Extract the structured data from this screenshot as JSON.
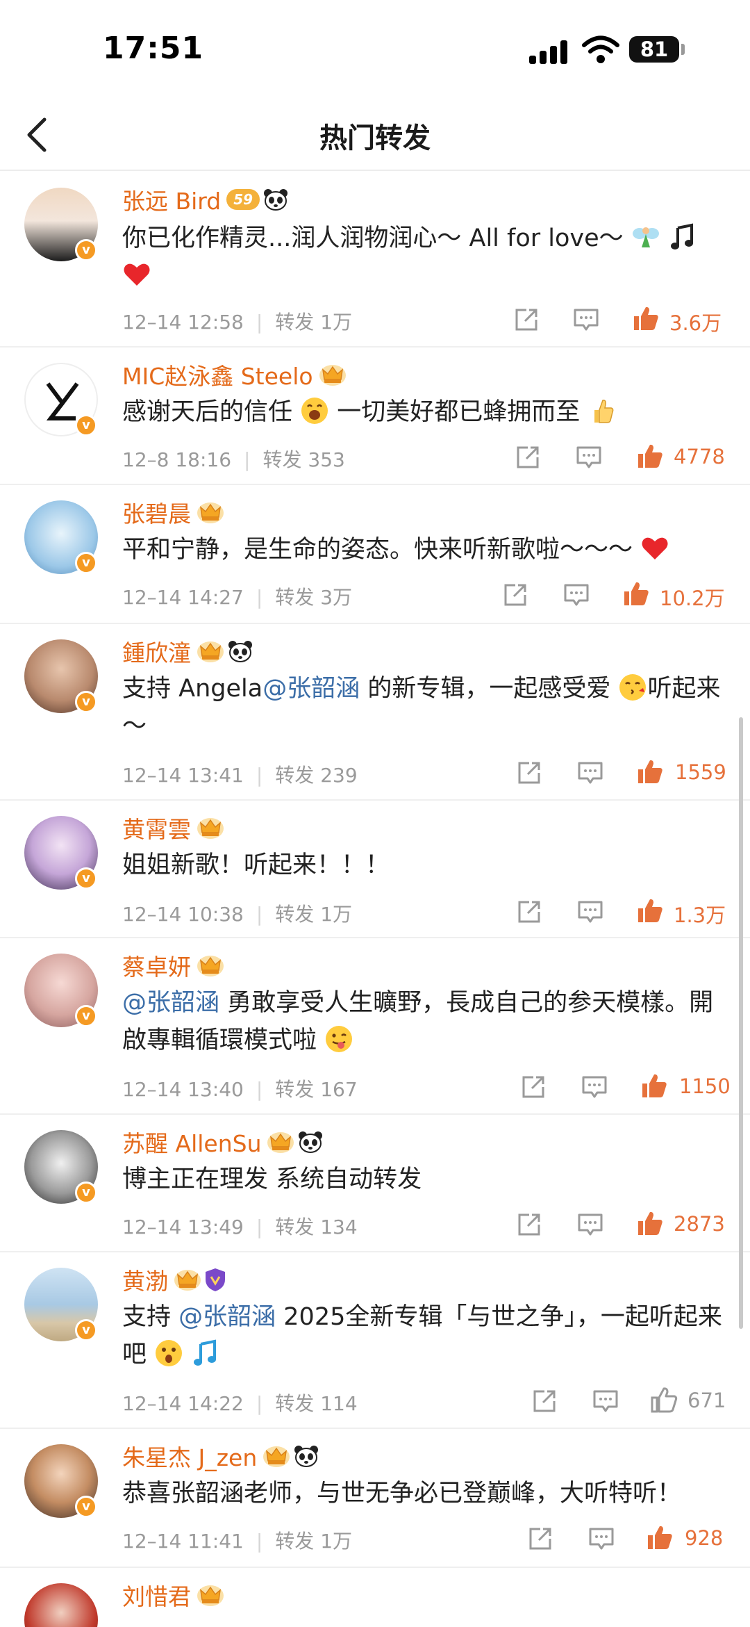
{
  "status_bar": {
    "time": "17:51",
    "battery": "81"
  },
  "header": {
    "title": "热门转发"
  },
  "colors": {
    "name": "#e46a1a",
    "like_active": "#e6713b",
    "mention": "#3c6ea8",
    "meta": "#9a9a9a"
  },
  "items": [
    {
      "name": "张远 Bird",
      "badges": [
        "level-badge",
        "panda-icon"
      ],
      "level": "59",
      "text": "你已化作精灵...润人润物润心～ All for love～",
      "time": "12–14 12:58",
      "repost_label": "转发",
      "reposts": "1万",
      "likes": "3.6万",
      "liked": true
    },
    {
      "name": "MIC赵泳鑫 Steelo",
      "badges": [
        "crown-icon"
      ],
      "text": "感谢天后的信任",
      "text2": " 一切美好都已蜂拥而至",
      "time": "12–8 18:16",
      "repost_label": "转发",
      "reposts": "353",
      "likes": "4778",
      "liked": true
    },
    {
      "name": "张碧晨",
      "badges": [
        "crown-icon"
      ],
      "text": "平和宁静，是生命的姿态。快来听新歌啦～～～",
      "time": "12–14 14:27",
      "repost_label": "转发",
      "reposts": "3万",
      "likes": "10.2万",
      "liked": true
    },
    {
      "name": "鍾欣潼",
      "badges": [
        "crown-icon",
        "panda-icon"
      ],
      "text_a": "支持 Angela",
      "mention": "@张韶涵",
      "text_b": " 的新专辑，一起感受爱",
      "text_c": "听起来～",
      "time": "12–14 13:41",
      "repost_label": "转发",
      "reposts": "239",
      "likes": "1559",
      "liked": true
    },
    {
      "name": "黄霄雲",
      "badges": [
        "crown-icon"
      ],
      "text": "姐姐新歌！听起来！！！",
      "time": "12–14 10:38",
      "repost_label": "转发",
      "reposts": "1万",
      "likes": "1.3万",
      "liked": true
    },
    {
      "name": "蔡卓妍",
      "badges": [
        "crown-icon"
      ],
      "mention": "@张韶涵",
      "text_a": " 勇敢享受人生曠野，長成自己的参天模樣。開啟專輯循環模式啦",
      "time": "12–14 13:40",
      "repost_label": "转发",
      "reposts": "167",
      "likes": "1150",
      "liked": true
    },
    {
      "name": "苏醒 AllenSu",
      "badges": [
        "crown-icon",
        "panda-icon"
      ],
      "text": "博主正在理发 系统自动转发",
      "time": "12–14 13:49",
      "repost_label": "转发",
      "reposts": "134",
      "likes": "2873",
      "liked": true
    },
    {
      "name": "黄渤",
      "badges": [
        "crown-icon",
        "shield-icon"
      ],
      "text_a": "支持 ",
      "mention": "@张韶涵",
      "text_b": " 2025全新专辑「与世之争」，一起听起来吧",
      "time": "12–14 14:22",
      "repost_label": "转发",
      "reposts": "114",
      "likes": "671",
      "liked": false
    },
    {
      "name": "朱星杰 J_zen",
      "badges": [
        "crown-icon",
        "panda-icon"
      ],
      "text": "恭喜张韶涵老师，与世无争必已登巅峰，大听特听！",
      "time": "12–14 11:41",
      "repost_label": "转发",
      "reposts": "1万",
      "likes": "928",
      "liked": true
    },
    {
      "name": "刘惜君",
      "badges": [
        "crown-icon"
      ]
    }
  ]
}
